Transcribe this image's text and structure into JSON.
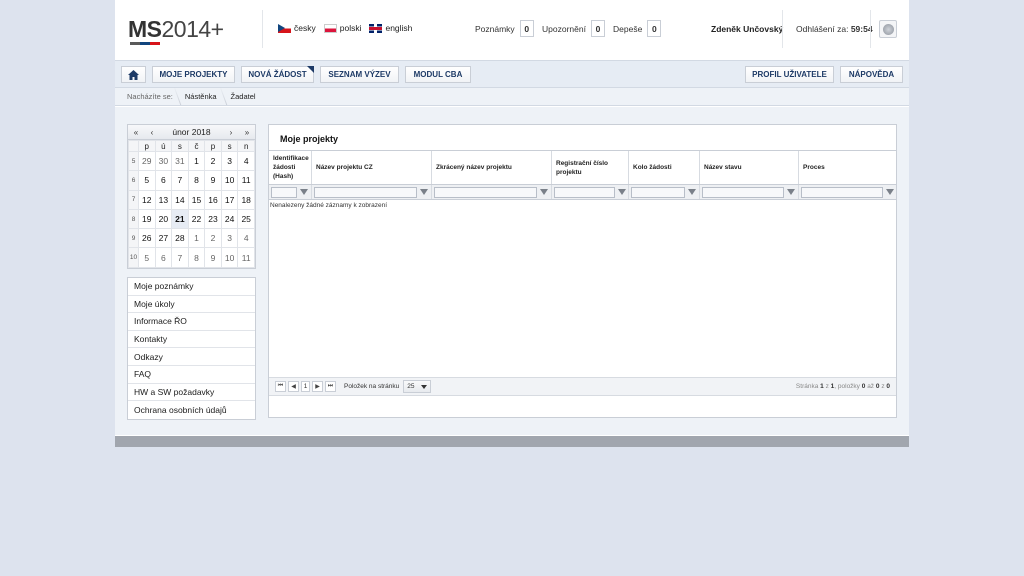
{
  "logo": {
    "text_ms": "MS",
    "text_year": "2014+",
    "colors": [
      "#5a5a5a",
      "#d7141a",
      "#11457e"
    ]
  },
  "languages": [
    {
      "label": "česky",
      "flag": "cz-flag-icon"
    },
    {
      "label": "polski",
      "flag": "pl-flag-icon"
    },
    {
      "label": "english",
      "flag": "gb-flag-icon"
    }
  ],
  "counters": {
    "notes": {
      "label": "Poznámky",
      "value": "0"
    },
    "alerts": {
      "label": "Upozornění",
      "value": "0"
    },
    "messages": {
      "label": "Depeše",
      "value": "0"
    }
  },
  "user": {
    "name": "Zdeněk Unčovský",
    "logout_label": "Odhlášení za:",
    "logout_time": "59:54"
  },
  "nav": {
    "home_icon": "home-icon",
    "items": [
      "MOJE PROJEKTY",
      "NOVÁ ŽÁDOST",
      "SEZNAM VÝZEV",
      "MODUL CBA"
    ],
    "right": [
      "PROFIL UŽIVATELE",
      "NÁPOVĚDA"
    ]
  },
  "breadcrumb": {
    "label": "Nacházíte se:",
    "items": [
      "Nástěnka",
      "Žadatel"
    ]
  },
  "calendar": {
    "month": "únor 2018",
    "weekdays": [
      "p",
      "ú",
      "s",
      "č",
      "p",
      "s",
      "n"
    ],
    "weeks": [
      {
        "wk": "5",
        "days": [
          "29",
          "30",
          "31",
          "1",
          "2",
          "3",
          "4"
        ]
      },
      {
        "wk": "6",
        "days": [
          "5",
          "6",
          "7",
          "8",
          "9",
          "10",
          "11"
        ]
      },
      {
        "wk": "7",
        "days": [
          "12",
          "13",
          "14",
          "15",
          "16",
          "17",
          "18"
        ]
      },
      {
        "wk": "8",
        "days": [
          "19",
          "20",
          "21",
          "22",
          "23",
          "24",
          "25"
        ]
      },
      {
        "wk": "9",
        "days": [
          "26",
          "27",
          "28",
          "1",
          "2",
          "3",
          "4"
        ]
      },
      {
        "wk": "10",
        "days": [
          "5",
          "6",
          "7",
          "8",
          "9",
          "10",
          "11"
        ]
      }
    ],
    "today": "21"
  },
  "side_menu": [
    "Moje poznámky",
    "Moje úkoly",
    "Informace ŘO",
    "Kontakty",
    "Odkazy",
    "FAQ",
    "HW a SW požadavky",
    "Ochrana osobních údajů"
  ],
  "grid": {
    "title": "Moje projekty",
    "columns": [
      "Identifikace žádosti (Hash)",
      "Název projektu CZ",
      "Zkrácený název projektu",
      "Registrační číslo projektu",
      "Kolo žádosti",
      "Název stavu",
      "Proces"
    ],
    "empty_text": "Nenalezeny žádné záznamy k zobrazení",
    "pager": {
      "page": "1",
      "page_size_label": "Položek na stránku",
      "page_size": "25",
      "info_page_prefix": "Stránka",
      "info_page": "1",
      "info_of": "z",
      "info_pages": "1",
      "info_items": "položky",
      "info_from": "0",
      "info_to_word": "až",
      "info_to": "0",
      "info_total": "0"
    }
  }
}
